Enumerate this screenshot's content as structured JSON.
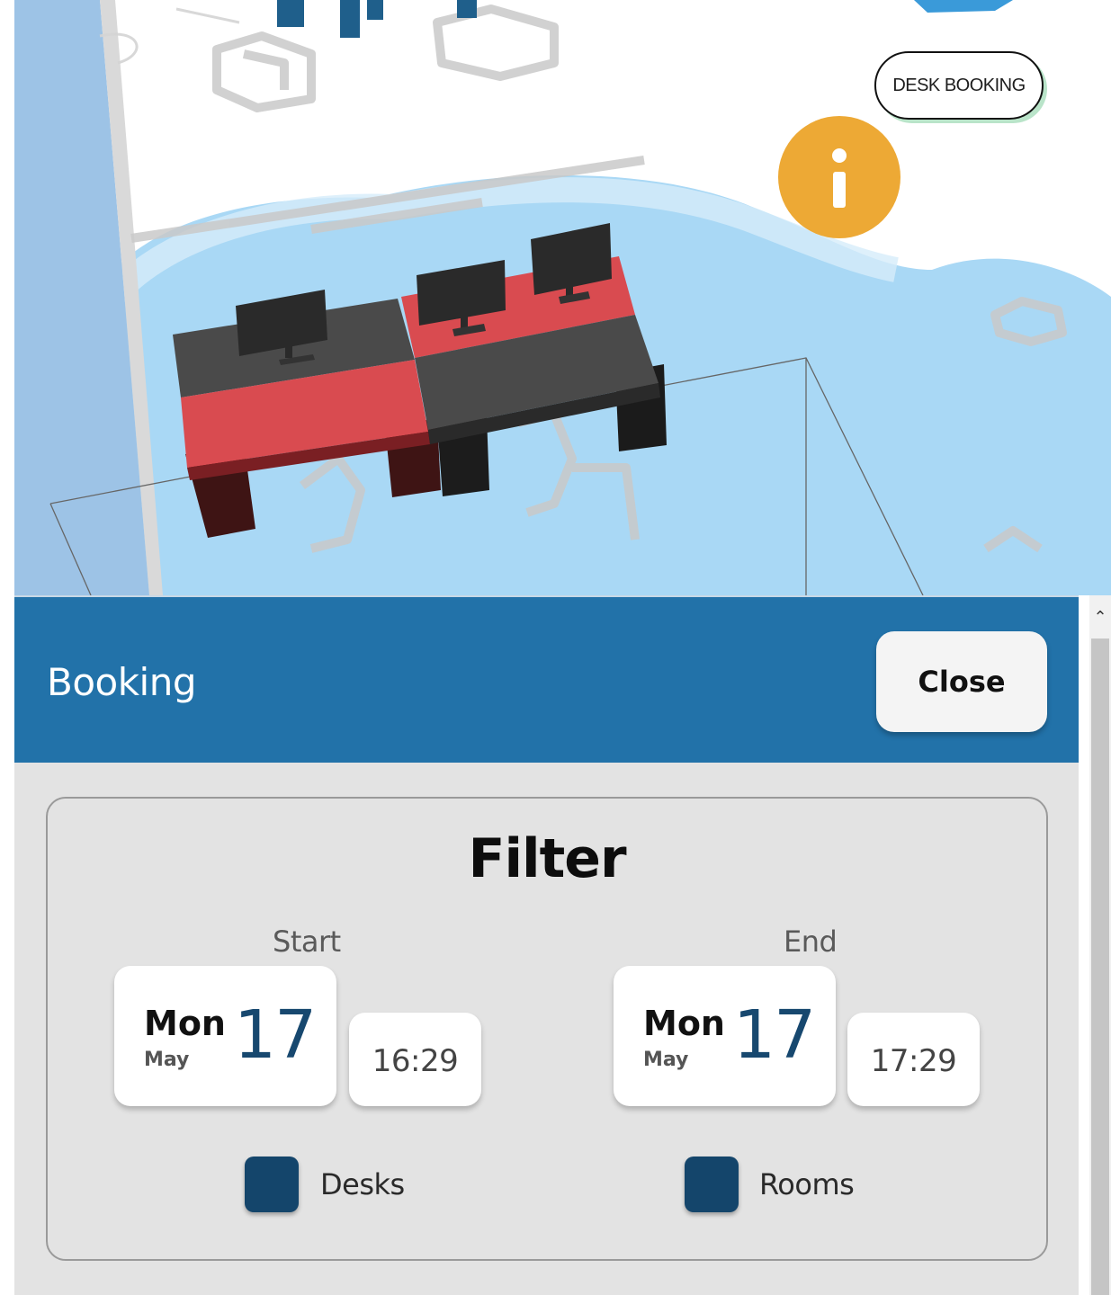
{
  "map": {
    "bubble_text": "DESK BOOKING",
    "info_icon": "info-icon",
    "colors": {
      "floor_blue": "#a9d8f5",
      "wall_blue": "#9dc3e6",
      "desk_red": "#d94b50",
      "desk_dark": "#494949",
      "info_orange": "#eda935"
    }
  },
  "panel": {
    "title": "Booking",
    "close_label": "Close",
    "header_color": "#2272a9"
  },
  "filter": {
    "title": "Filter",
    "start": {
      "label": "Start",
      "day_of_week": "Mon",
      "month": "May",
      "day": "17",
      "time": "16:29"
    },
    "end": {
      "label": "End",
      "day_of_week": "Mon",
      "month": "May",
      "day": "17",
      "time": "17:29"
    },
    "options": [
      {
        "label": "Desks",
        "checked": true
      },
      {
        "label": "Rooms",
        "checked": true
      }
    ],
    "checkbox_color": "#14456b"
  },
  "scrollbar": {
    "up_arrow_icon": "chevron-up-icon"
  }
}
